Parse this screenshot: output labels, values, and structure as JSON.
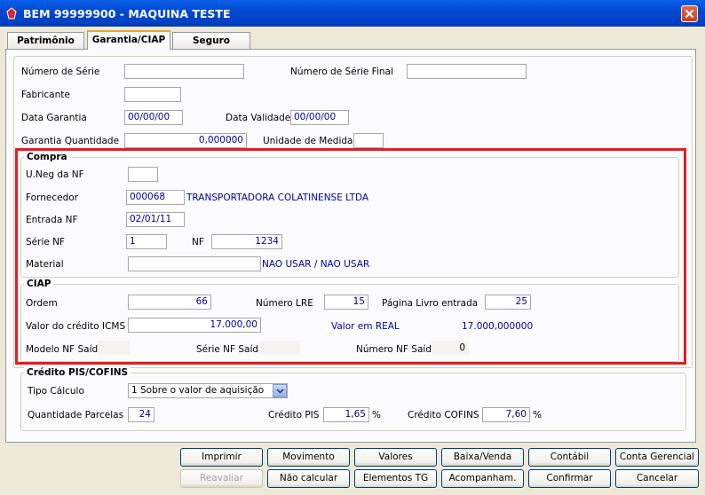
{
  "window": {
    "title": "BEM 99999900 - MAQUINA TESTE"
  },
  "tabs": [
    {
      "label": "Patrimônio"
    },
    {
      "label": "Garantia/CIAP"
    },
    {
      "label": "Seguro"
    }
  ],
  "top_fields": {
    "numero_serie_label": "Número de Série",
    "numero_serie_final_label": "Número de Série Final",
    "fabricante_label": "Fabricante",
    "data_garantia_label": "Data Garantia",
    "data_garantia_value": "00/00/00",
    "data_validade_label": "Data Validade",
    "data_validade_value": "00/00/00",
    "garantia_quantidade_label": "Garantia Quantidade",
    "garantia_quantidade_value": "0,000000",
    "unidade_medida_label": "Unidade de Medida"
  },
  "compra": {
    "title": "Compra",
    "uneg_label": "U.Neg da NF",
    "fornecedor_label": "Fornecedor",
    "fornecedor_code": "000068",
    "fornecedor_name": "TRANSPORTADORA COLATINENSE LTDA",
    "entrada_label": "Entrada NF",
    "entrada_value": "02/01/11",
    "serie_label": "Série NF",
    "serie_value": "1",
    "nf_label": "NF",
    "nf_value": "1234",
    "material_label": "Material",
    "material_value": "NAO USAR / NAO USAR"
  },
  "ciap": {
    "title": "CIAP",
    "ordem_label": "Ordem",
    "ordem_value": "66",
    "numero_lre_label": "Número LRE",
    "numero_lre_value": "15",
    "pagina_label": "Página Livro entrada",
    "pagina_value": "25",
    "valor_credito_label": "Valor do crédito ICMS",
    "valor_credito_value": "17.000,00",
    "valor_real_label": "Valor em REAL",
    "valor_real_value": "17.000,000000",
    "modelo_label": "Modelo NF Saída",
    "serie_saida_label": "Série NF Saída",
    "numero_saida_label": "Número NF Saída",
    "numero_saida_value": "0"
  },
  "pis": {
    "title": "Crédito PIS/COFINS",
    "tipo_label": "Tipo Cálculo",
    "tipo_value": "1  Sobre o valor de aquisição",
    "qtd_label": "Quantidade Parcelas",
    "qtd_value": "24",
    "credito_pis_label": "Crédito PIS",
    "credito_pis_value": "1,65",
    "credito_cofins_label": "Crédito COFINS",
    "credito_cofins_value": "7,60",
    "percent": "%"
  },
  "buttons": {
    "imprimir": "Imprimir",
    "movimento": "Movimento",
    "valores": "Valores",
    "baixa": "Baixa/Venda",
    "contabil": "Contábil",
    "conta_gerencial": "Conta Gerencial",
    "reavaliar": "Reavaliar",
    "nao_calcular": "Não calcular",
    "elementos": "Elementos TG",
    "acompanham": "Acompanham.",
    "confirmar": "Confirmar",
    "cancelar": "Cancelar"
  },
  "colors": {
    "highlight": "#e51b23",
    "title_bar": "#0047d0",
    "value_text": "#0000a0"
  }
}
